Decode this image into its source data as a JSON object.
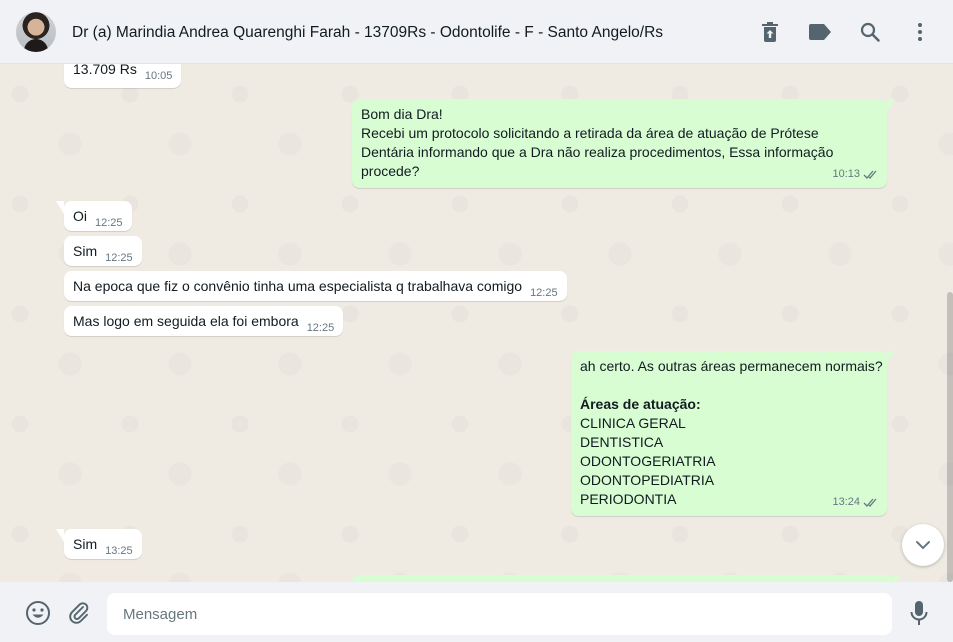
{
  "header": {
    "contact_name": "Dr (a) Marindia Andrea Quarenghi Farah - 13709Rs - Odontolife - F - Santo Angelo/Rs",
    "icons": [
      "trash-upload-icon",
      "label-icon",
      "search-icon",
      "more-vertical-icon"
    ]
  },
  "messages": [
    {
      "dir": "in",
      "lines": [
        "13.709 Rs"
      ],
      "time": "10:05"
    },
    {
      "dir": "out",
      "lines": [
        "Bom dia Dra!",
        "Recebi um protocolo solicitando a retirada da área de atuação de  Prótese",
        "Dentária informando que a Dra não realiza procedimentos, Essa informação",
        "procede?"
      ],
      "time": "10:13",
      "status": "read"
    },
    {
      "dir": "in",
      "lines": [
        "Oi"
      ],
      "time": "12:25"
    },
    {
      "dir": "in",
      "lines": [
        "Sim"
      ],
      "time": "12:25"
    },
    {
      "dir": "in",
      "lines": [
        "Na epoca que fiz o convênio tinha uma especialista q trabalhava comigo"
      ],
      "time": "12:25"
    },
    {
      "dir": "in",
      "lines": [
        "Mas logo em seguida ela foi embora"
      ],
      "time": "12:25"
    },
    {
      "dir": "out",
      "lines": [
        "ah certo. As outras áreas permanecem normais?",
        "",
        "Áreas de atuação:",
        "CLINICA GERAL",
        "DENTISTICA",
        "ODONTOGERIATRIA",
        "ODONTOPEDIATRIA",
        "PERIODONTIA"
      ],
      "time": "13:24",
      "status": "read"
    },
    {
      "dir": "in",
      "lines": [
        "Sim"
      ],
      "time": "13:25"
    }
  ],
  "footer": {
    "placeholder": "Mensagem",
    "icons": [
      "emoji-icon",
      "attach-icon",
      "microphone-icon"
    ]
  },
  "colors": {
    "header_bg": "#f0f2f5",
    "chat_bg": "#efeae2",
    "incoming_bubble": "#ffffff",
    "outgoing_bubble": "#d9fdd3",
    "meta_text": "#667781",
    "read_ticks": "#667781"
  }
}
